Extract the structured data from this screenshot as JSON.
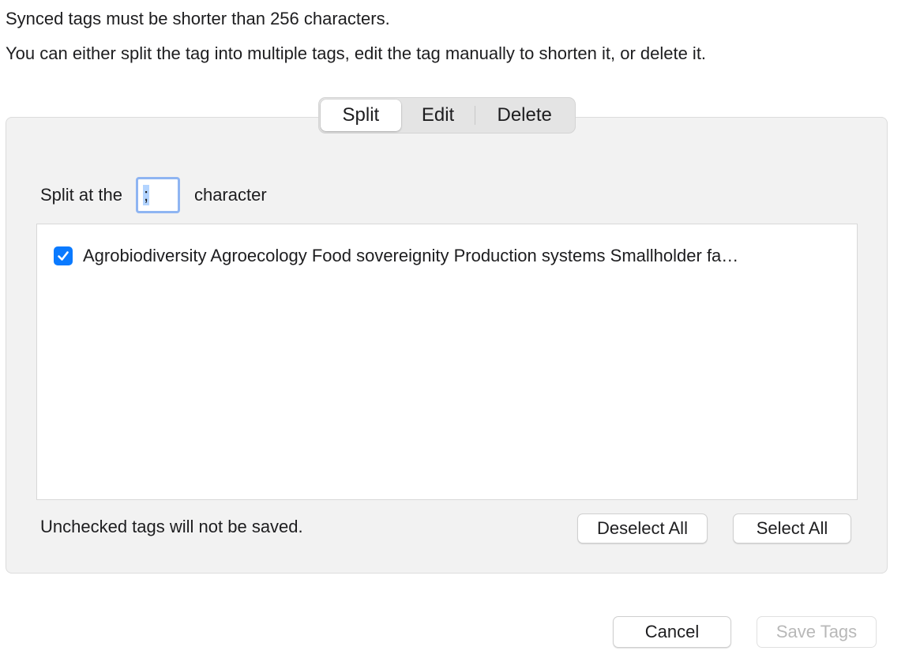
{
  "messages": {
    "line1": "Synced tags must be shorter than 256 characters.",
    "line2": "You can either split the tag into multiple tags, edit the tag manually to shorten it, or delete it."
  },
  "tabs": {
    "split": "Split",
    "edit": "Edit",
    "delete": "Delete",
    "selected": "Split"
  },
  "split_row": {
    "prefix": "Split at the",
    "delimiter_value": ";",
    "suffix": "character"
  },
  "tag_list": {
    "items": [
      {
        "checked": true,
        "label": "Agrobiodiversity Agroecology Food sovereignity Production systems Smallholder fa…"
      }
    ]
  },
  "footer_panel": {
    "hint": "Unchecked tags will not be saved.",
    "deselect_all": "Deselect All",
    "select_all": "Select All"
  },
  "dialog_buttons": {
    "cancel": "Cancel",
    "save": "Save Tags"
  },
  "colors": {
    "accent": "#0a7aff",
    "focus_ring": "#8fb5f2",
    "panel_bg": "#f2f2f2",
    "disabled_text": "#b8b8b8"
  }
}
